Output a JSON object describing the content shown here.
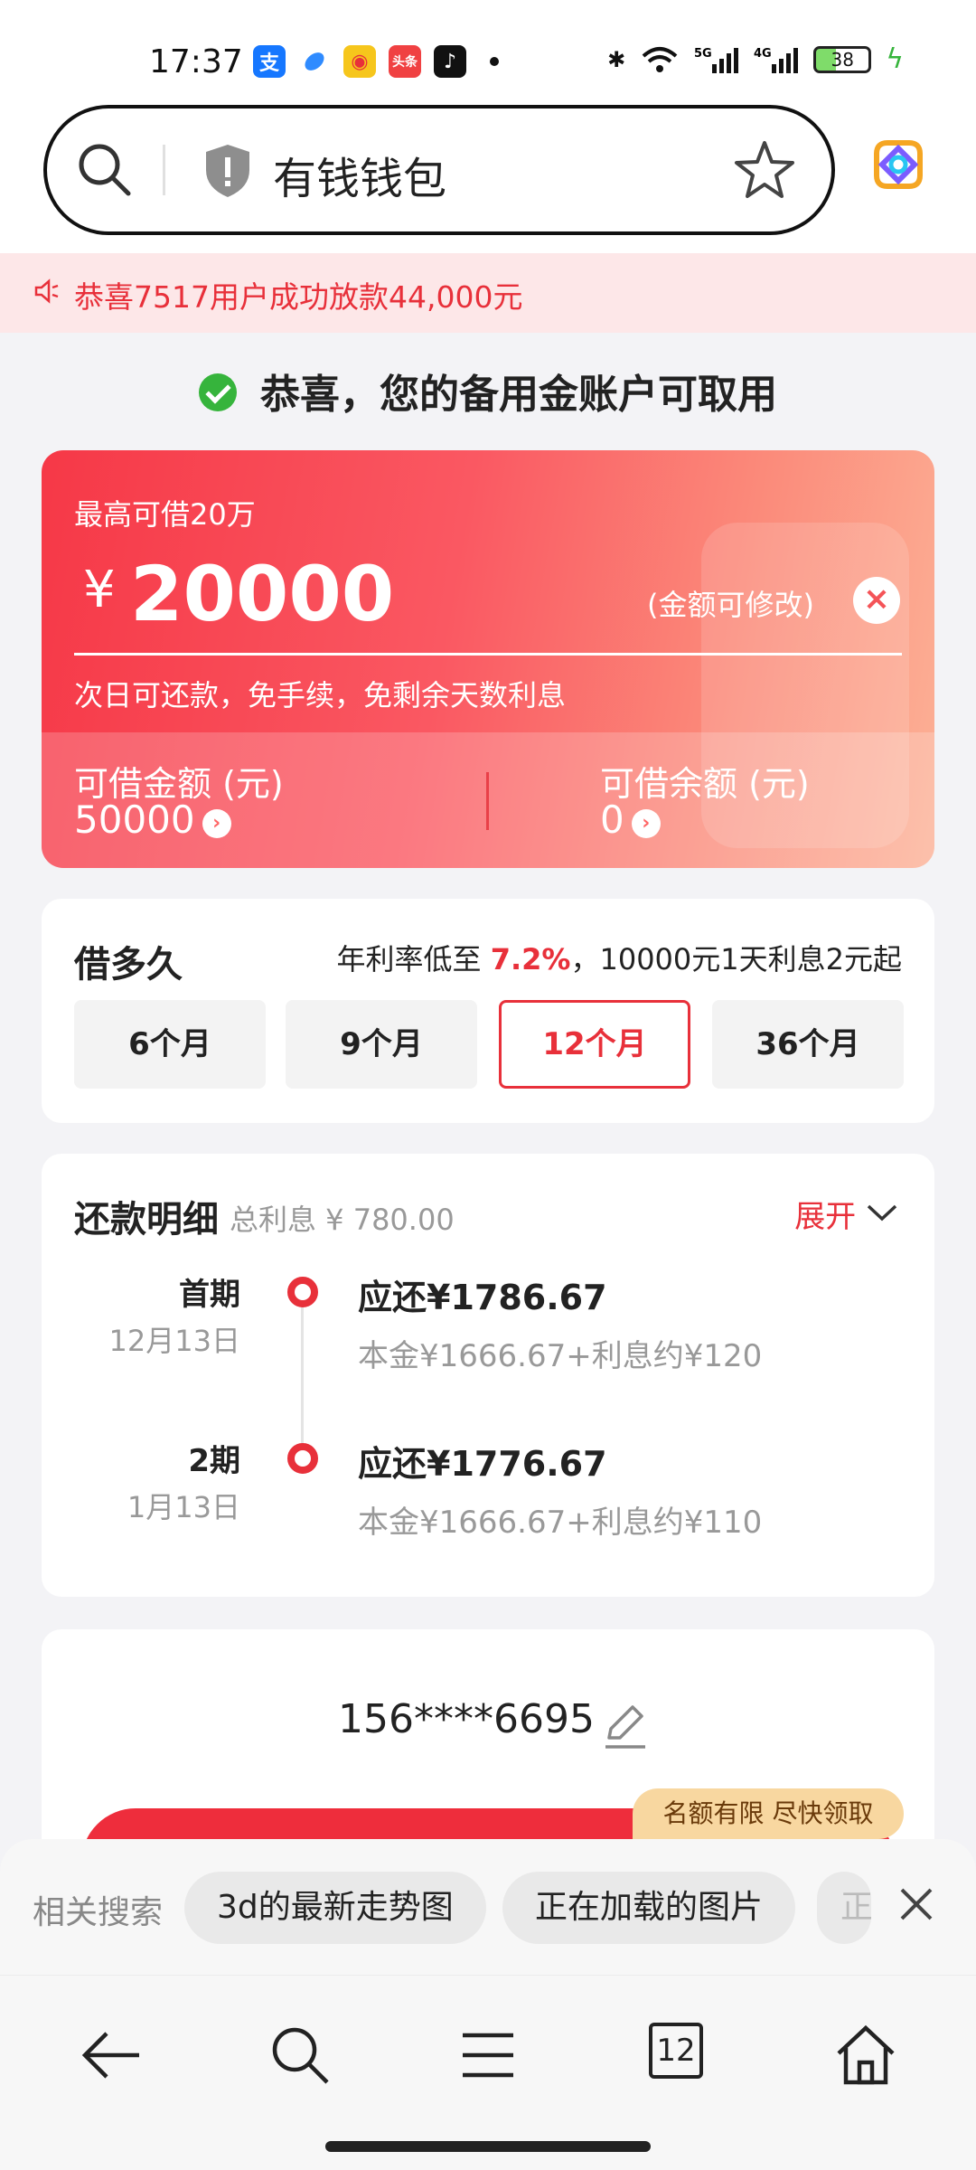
{
  "status_bar": {
    "time": "17:37",
    "app_icons": [
      "alipay-icon",
      "browser-icon",
      "game-icon",
      "toutiao-icon",
      "tiktok-icon"
    ],
    "battery": "38"
  },
  "search": {
    "title": "有钱钱包"
  },
  "notice": {
    "text": "恭喜7517用户成功放款44,000元"
  },
  "success": {
    "text": "恭喜，您的备用金账户可取用"
  },
  "loan_card": {
    "max_label": "最高可借20万",
    "currency": "¥",
    "amount": "20000",
    "editable_hint": "(金额可修改)",
    "clear": "×",
    "features": "次日可还款，免手续，免剩余天数利息",
    "available_label": "可借金额 (元)",
    "available_value": "50000",
    "balance_label": "可借余额 (元)",
    "balance_value": "0"
  },
  "term": {
    "title": "借多久",
    "rate_prefix": "年利率低至 ",
    "rate_value": "7.2%",
    "rate_suffix": "，10000元1天利息2元起",
    "options": [
      "6个月",
      "9个月",
      "12个月",
      "36个月"
    ],
    "selected": "12个月"
  },
  "repayment": {
    "title": "还款明细",
    "total_interest": "总利息 ¥ 780.00",
    "expand": "展开",
    "items": [
      {
        "period": "首期",
        "date": "12月13日",
        "due": "应还¥1786.67",
        "detail": "本金¥1666.67+利息约¥120"
      },
      {
        "period": "2期",
        "date": "1月13日",
        "due": "应还¥1776.67",
        "detail": "本金¥1666.67+利息约¥110"
      }
    ]
  },
  "phone": {
    "number": "156****6695",
    "badge": "名额有限 尽快领取"
  },
  "related_search": {
    "label": "相关搜索",
    "chips": [
      "3d的最新走势图",
      "正在加载的图片",
      "正"
    ]
  },
  "nav": {
    "tabs_count": "12"
  }
}
